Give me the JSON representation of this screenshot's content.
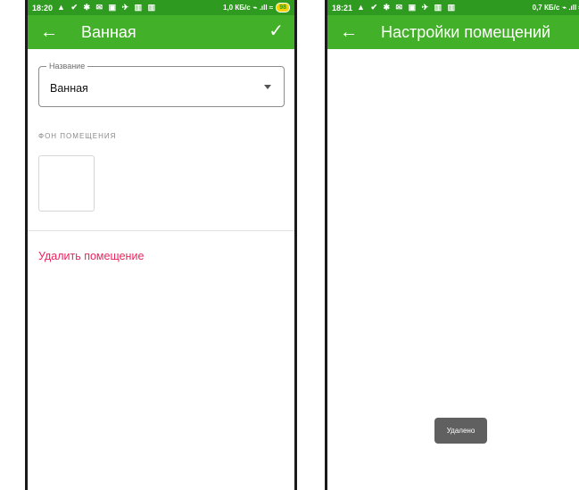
{
  "left_screen": {
    "status_bar": {
      "time": "18:20",
      "icons": "▲ ✔ ✱ ✉ ▣ ✈ ▥ ▥",
      "speed": "1,0 КБ/с",
      "signal": "⌁ .ıll ≈",
      "battery": "98"
    },
    "app_bar": {
      "back": "←",
      "title": "Ванная",
      "action": "✓"
    },
    "name_field": {
      "legend": "Название",
      "value": "Ванная"
    },
    "background_section": {
      "label": "ФОН ПОМЕЩЕНИЯ"
    },
    "delete_link": "Удалить помещение"
  },
  "right_screen": {
    "status_bar": {
      "time": "18:21",
      "icons": "▲ ✔ ✱ ✉ ▣ ✈ ▥ ▥",
      "speed": "0,7 КБ/с",
      "signal": "⌁ .ıll ≈ ◯"
    },
    "app_bar": {
      "back": "←",
      "title": "Настройки помещений",
      "action": "+"
    },
    "toast": "Удалено"
  },
  "colors": {
    "status_bar": "#2e9a1f",
    "app_bar": "#43b02a",
    "delete_text": "#e8265e",
    "toast_bg": "#606060"
  }
}
